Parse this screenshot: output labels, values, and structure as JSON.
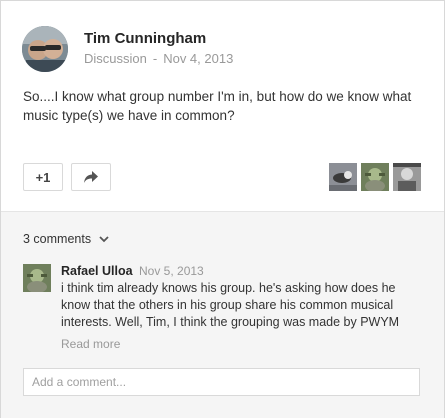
{
  "post": {
    "author": "Tim Cunningham",
    "category": "Discussion",
    "separator": "-",
    "date": "Nov 4, 2013",
    "text": "So....I know what group number I'm in, but how do we know what music type(s) we have in common?",
    "plus_one_label": "+1",
    "share_icon": "share-arrow-icon",
    "sharers_count": 3
  },
  "comments": {
    "toggle_label": "3 comments",
    "toggle_icon": "chevron-down-icon",
    "items": [
      {
        "author": "Rafael Ulloa",
        "date": "Nov 5, 2013",
        "text": "i think tim already knows his group. he's asking how does he know that the others in his group share his common musical interests. Well, Tim, I think the grouping was made by PWYM",
        "read_more": "Read more"
      }
    ],
    "input_placeholder": "Add a comment..."
  },
  "colors": {
    "card_bg": "#ffffff",
    "comments_bg": "#f5f5f5",
    "muted_text": "#999999",
    "border": "#d9d9d9"
  }
}
